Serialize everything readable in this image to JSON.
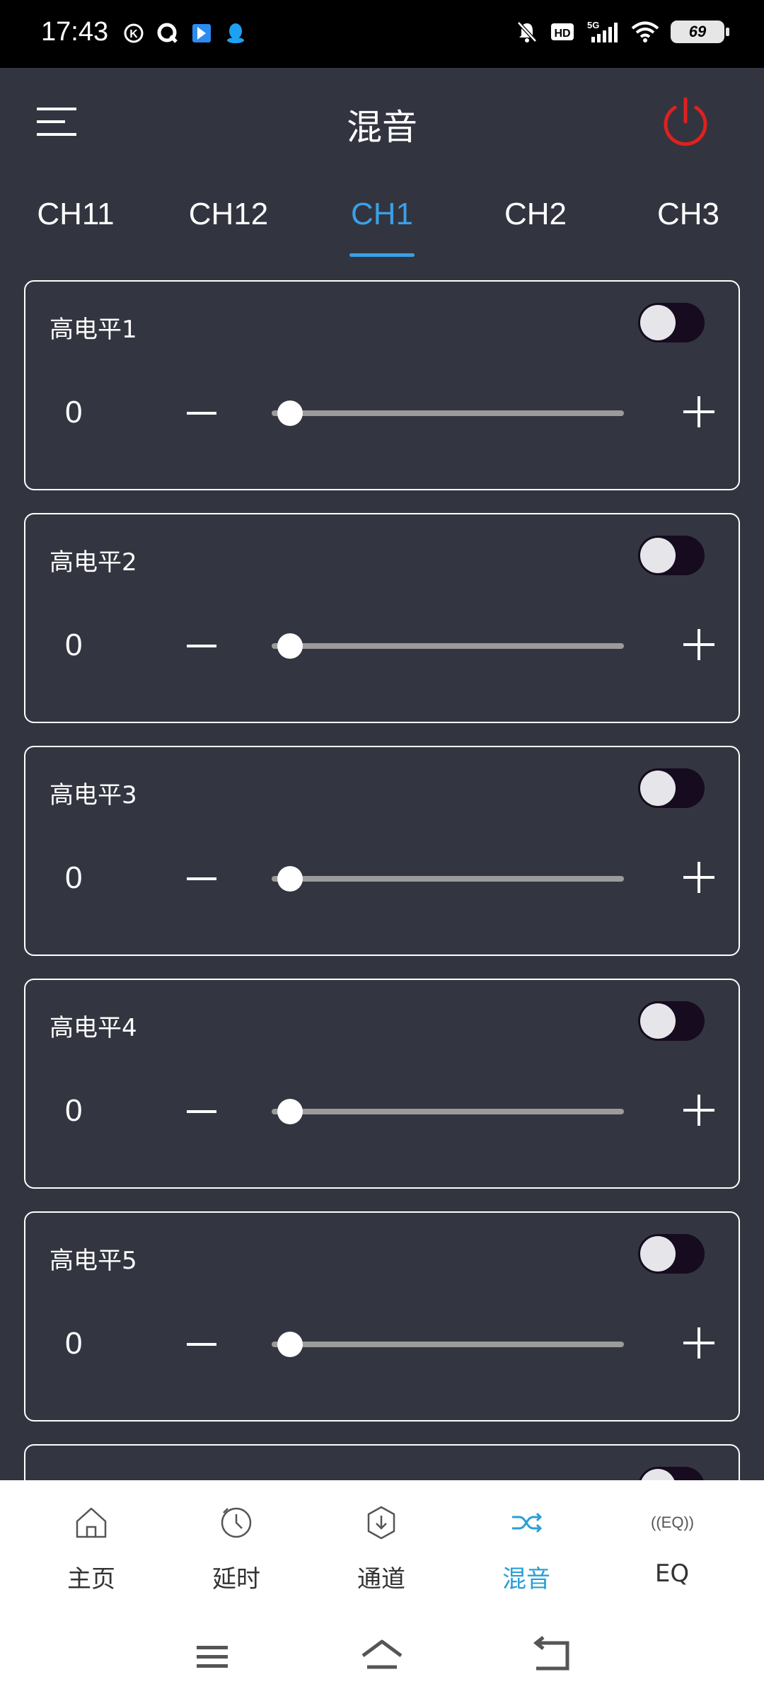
{
  "status_bar": {
    "time": "17:43",
    "battery": "69",
    "icons_left": [
      "k-circle-icon",
      "browser-icon",
      "app-flag-icon",
      "qq-icon"
    ],
    "icons_right": [
      "mute-bell-icon",
      "hd-icon",
      "5g-signal-icon",
      "wifi-icon"
    ],
    "hd_label": "HD",
    "network_label": "5G"
  },
  "header": {
    "title": "混音",
    "menu_icon": "menu-icon",
    "power_icon": "power-icon",
    "power_color": "#e02020"
  },
  "tabs": [
    {
      "label": "CH11",
      "active": false
    },
    {
      "label": "CH12",
      "active": false
    },
    {
      "label": "CH1",
      "active": true
    },
    {
      "label": "CH2",
      "active": false
    },
    {
      "label": "CH3",
      "active": false
    }
  ],
  "accent_color": "#3aa0e8",
  "channels": [
    {
      "title": "高电平1",
      "value": "0",
      "enabled": false,
      "level": 0
    },
    {
      "title": "高电平2",
      "value": "0",
      "enabled": false,
      "level": 0
    },
    {
      "title": "高电平3",
      "value": "0",
      "enabled": false,
      "level": 0
    },
    {
      "title": "高电平4",
      "value": "0",
      "enabled": false,
      "level": 0
    },
    {
      "title": "高电平5",
      "value": "0",
      "enabled": false,
      "level": 0
    }
  ],
  "bottom_nav": [
    {
      "label": "主页",
      "icon": "home-icon",
      "active": false
    },
    {
      "label": "延时",
      "icon": "clock-icon",
      "active": false
    },
    {
      "label": "通道",
      "icon": "channel-icon",
      "active": false
    },
    {
      "label": "混音",
      "icon": "shuffle-icon",
      "active": true
    },
    {
      "label": "EQ",
      "icon": "eq-icon",
      "active": false
    }
  ],
  "eq_icon_text": "((EQ))",
  "system_nav": [
    "recent-apps-icon",
    "home-gesture-icon",
    "back-icon"
  ]
}
